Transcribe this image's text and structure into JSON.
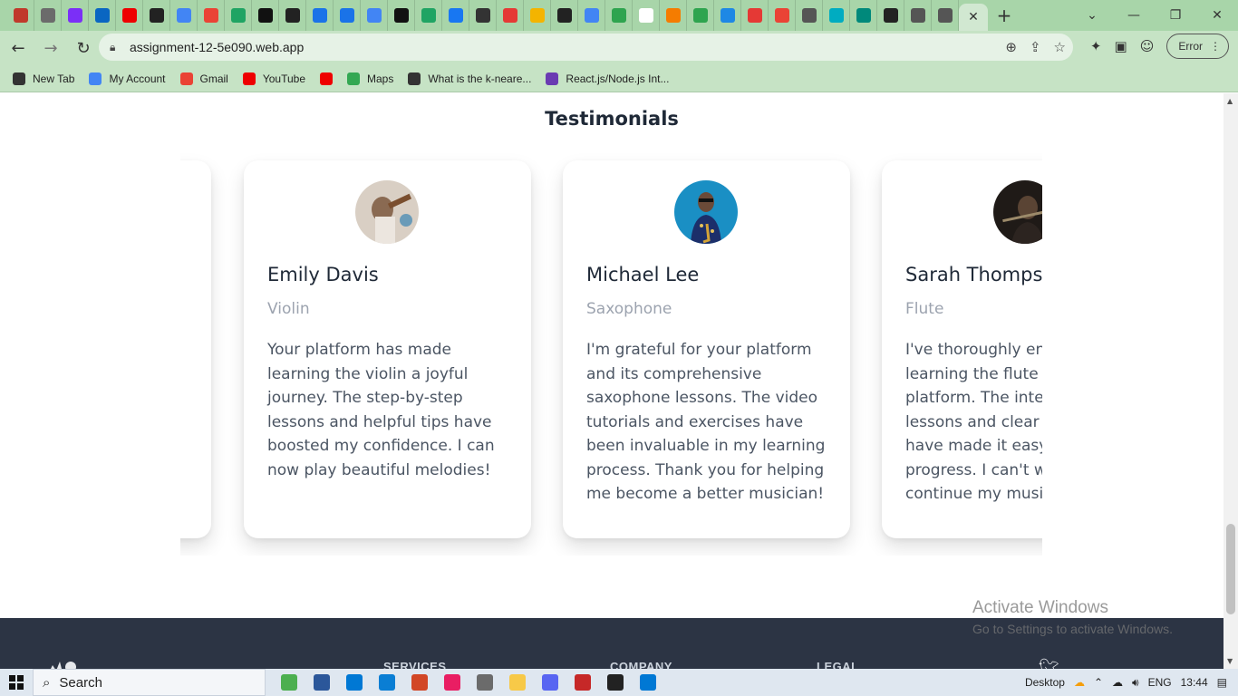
{
  "browser": {
    "url": "assignment-12-5e090.web.app",
    "error_label": "Error",
    "tab_colors": [
      "#c0392b",
      "#6b6b6b",
      "#7b2ff7",
      "#0a66c2",
      "#e00",
      "#222",
      "#4285f4",
      "#ea4335",
      "#1fa463",
      "#111",
      "#222",
      "#1a73e8",
      "#1a73e8",
      "#4285f4",
      "#111",
      "#1fa463",
      "#1877f2",
      "#333",
      "#e53935",
      "#f4b400",
      "#222",
      "#4285f4",
      "#2ea44f",
      "#fff",
      "#f57c00",
      "#2ea44f",
      "#1e88e5",
      "#e53935",
      "#ea4335",
      "#555",
      "#00acc1",
      "#00897b",
      "#222",
      "#555",
      "#555"
    ],
    "bookmarks": [
      {
        "label": "New Tab",
        "icon": "globe-icon",
        "color": "#333"
      },
      {
        "label": "My Account",
        "icon": "google-icon",
        "color": "#4285f4"
      },
      {
        "label": "Gmail",
        "icon": "gmail-icon",
        "color": "#ea4335"
      },
      {
        "label": "YouTube",
        "icon": "youtube-icon",
        "color": "#e00"
      },
      {
        "label": "",
        "icon": "youtube-icon",
        "color": "#e00"
      },
      {
        "label": "Maps",
        "icon": "maps-icon",
        "color": "#34a853"
      },
      {
        "label": "What is the k-neare...",
        "icon": "network-icon",
        "color": "#333"
      },
      {
        "label": "React.js/Node.js Int...",
        "icon": "list-icon",
        "color": "#6a3ab2"
      }
    ]
  },
  "section": {
    "title": "Testimonials"
  },
  "testimonials": [
    {
      "name": "Emily Davis",
      "instrument": "Violin",
      "quote": "Your platform has made learning the violin a joyful journey. The step-by-step lessons and helpful tips have boosted my confidence. I can now play beautiful melodies!",
      "avatar_color": "#b8a89a"
    },
    {
      "name": "Michael Lee",
      "instrument": "Saxophone",
      "quote": "I'm grateful for your platform and its comprehensive saxophone lessons. The video tutorials and exercises have been invaluable in my learning process. Thank you for helping me become a better musician!",
      "avatar_color": "#1a8fc4"
    },
    {
      "name": "Sarah Thompson",
      "instrument": "Flute",
      "quote": "I've thoroughly enjoyed learning the flute through your platform. The interactive lessons and clear explanations have made it easy for me to progress. I can't wait to continue my musical journey!",
      "avatar_color": "#2a2420"
    }
  ],
  "watermark": {
    "line1": "Activate Windows",
    "line2": "Go to Settings to activate Windows."
  },
  "footer": {
    "services": "SERVICES",
    "company": "COMPANY",
    "legal": "LEGAL"
  },
  "taskbar": {
    "search_label": "Search",
    "desktop_label": "Desktop",
    "language": "ENG",
    "time": "13:44"
  }
}
